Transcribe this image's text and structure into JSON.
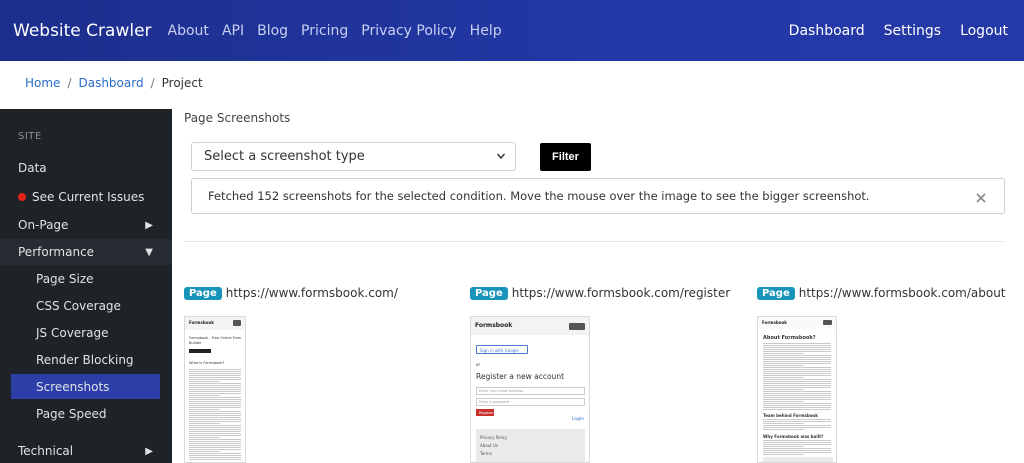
{
  "nav": {
    "brand": "Website Crawler",
    "links": [
      "About",
      "API",
      "Blog",
      "Pricing",
      "Privacy Policy",
      "Help"
    ],
    "right": [
      "Dashboard",
      "Settings",
      "Logout"
    ]
  },
  "breadcrumb": {
    "home": "Home",
    "dashboard": "Dashboard",
    "current": "Project",
    "separator": "/"
  },
  "sidebar": {
    "heading": "SITE",
    "items": [
      {
        "label": "Data"
      },
      {
        "label": "See Current Issues"
      },
      {
        "label": "On-Page",
        "arrow": "▶"
      },
      {
        "label": "Performance",
        "arrow": "▼"
      },
      {
        "label": "Page Size"
      },
      {
        "label": "CSS Coverage"
      },
      {
        "label": "JS Coverage"
      },
      {
        "label": "Render Blocking"
      },
      {
        "label": "Screenshots"
      },
      {
        "label": "Page Speed"
      },
      {
        "label": "Technical",
        "arrow": "▶"
      }
    ]
  },
  "main": {
    "title": "Page Screenshots",
    "select_value": "Select a screenshot type",
    "filter_label": "Filter",
    "alert_text": "Fetched 152 screenshots for the selected condition. Move the mouse over the image to see the bigger screenshot.",
    "cards": [
      {
        "badge": "Page",
        "url": "https://www.formsbook.com/"
      },
      {
        "badge": "Page",
        "url": "https://www.formsbook.com/register"
      },
      {
        "badge": "Page",
        "url": "https://www.formsbook.com/about"
      }
    ]
  },
  "thumbs": {
    "brand": "Formsbook",
    "t1": {
      "hero1": "Formsbook - Free Online Form",
      "hero2": "Builder",
      "section": "What is Formsbook?"
    },
    "t2": {
      "google": "Sign in with Google",
      "or": "or",
      "heading": "Register a new account",
      "email": "Enter your email address",
      "password": "Enter a password",
      "button": "Register",
      "login": "Login",
      "footer": [
        "Privacy Policy",
        "About Us",
        "Terms"
      ]
    },
    "t3": {
      "h1": "About Formsbook?",
      "h2": "Team behind Formsbook",
      "h3": "Why Formsbook was built?"
    }
  },
  "colors": {
    "nav_start": "#1c2e8c",
    "sidebar_bg": "#1e2327",
    "active_item": "#2c3fa8",
    "badge": "#1794b9",
    "issue_dot": "#e0201b"
  }
}
